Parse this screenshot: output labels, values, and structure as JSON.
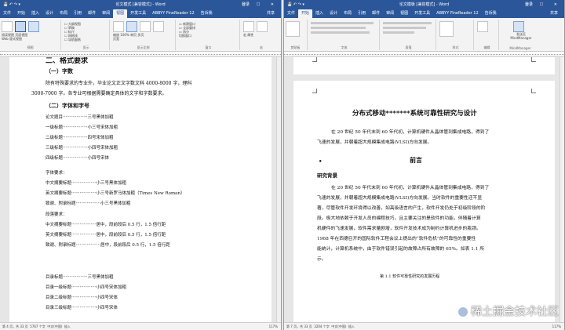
{
  "left": {
    "title": "论文模式 [兼容模式] - Word",
    "login": "登录",
    "window_controls": "— ☐ ✕",
    "share": "共享",
    "tabs": [
      "文件",
      "开始",
      "插入",
      "设计",
      "布局",
      "引用",
      "邮件",
      "审阅",
      "视图",
      "开发工具",
      "ABBYY FineReader 12",
      "告诉我"
    ],
    "active_tab_index": 8,
    "ribbon": {
      "views": [
        "阅读视图",
        "页面视图",
        "Web 版式视图"
      ],
      "show": [
        "大纲视图",
        "草稿"
      ],
      "checks": [
        "标尺",
        "网格线",
        "导航窗格"
      ],
      "zoom": [
        "缩放",
        "100%",
        "单页",
        "多页",
        "页宽"
      ],
      "window": [
        "新建窗口",
        "全部重排",
        "拆分"
      ],
      "others": [
        "切换窗口",
        "宏",
        "属性"
      ],
      "groups": [
        "视图",
        "显示",
        "显示比例",
        "窗口",
        "宏"
      ]
    },
    "status": {
      "page": "第 4 页，共 33 页",
      "words": "5767 个字",
      "lang": "中文(中国)",
      "mode": "插入",
      "zoom": "117%"
    },
    "content": {
      "h2": "二、格式要求",
      "h3a": "（一）字数",
      "p1a": "除有特殊要求的专业外，毕业论文正文字数文科 4000-8000 字，理科",
      "p1b": "3000-7000 字。各专业可根据需要确定具体的文字和字数要求。",
      "h3b": "（二）字体和字号",
      "fonts": [
        {
          "label": "论文题目",
          "val": "三号黑体加粗"
        },
        {
          "label": "一级标题",
          "val": "小三号宋体加粗"
        },
        {
          "label": "二级标题",
          "val": "四号宋体加粗"
        },
        {
          "label": "三级标题",
          "val": "小四号宋体加粗"
        },
        {
          "label": "四级标题",
          "val": "小四号宋体"
        }
      ],
      "subhead1": "字体要求：",
      "req": [
        {
          "label": "中文摘要标题",
          "val": "小三号黑体加粗"
        },
        {
          "label": "英文摘要标题",
          "val": "小三号新罗马体加粗（Times New Roman）"
        },
        {
          "label": "致谢、附录标题",
          "val": "小三号黑体加粗"
        }
      ],
      "subhead2": "段落要求：",
      "para": [
        {
          "label": "中文摘要标题",
          "val": "居中，段前段后 0.5 行，1.5 倍行距"
        },
        {
          "label": "英文摘要标题",
          "val": "居中，段前段后 0.5 行，1.5 倍行距"
        },
        {
          "label": "致谢、附录标题",
          "val": "居中，段前段后 0.5 行，1.5 倍行距"
        }
      ],
      "toc": [
        {
          "label": "目录标题",
          "val": "三号黑体加粗"
        },
        {
          "label": "目录一级标题",
          "val": "小四号宋体加粗"
        },
        {
          "label": "目录二级标题",
          "val": "小四号宋体"
        },
        {
          "label": "目录三级标题",
          "val": "小四号宋体"
        }
      ],
      "dots": "··················"
    }
  },
  "right": {
    "title": "论文模板 [兼容模式] - Word",
    "login": "登录",
    "window_controls": "— ☐ ✕",
    "share": "共享",
    "tabs": [
      "文件",
      "开始",
      "插入",
      "设计",
      "布局",
      "引用",
      "邮件",
      "审阅",
      "视图",
      "开发工具",
      "ABBYY FineReader 12",
      "告诉我"
    ],
    "active_tab_index": 1,
    "ribbon": {
      "groups": [
        "剪贴板",
        "字体",
        "段落",
        "样式",
        "编辑",
        "MindManager"
      ],
      "extras": [
        "发送至",
        "MindManager"
      ]
    },
    "status": {
      "page": "第 7 页，共 33 页",
      "words": "3204 个字",
      "lang": "中文(中国)",
      "mode": "插入",
      "zoom": "117%"
    },
    "content": {
      "title": "分布式移动*******系统可靠性研究与设计",
      "p1a": "在 20 世纪 50 年代末到 60 年代初，计算机硬件从晶体管到集成电路，得到了",
      "p1b": "飞速的发展，并朝着超大规模集成电路(VLSI)方向发展。",
      "h2": "前言",
      "h3": "研究背景",
      "body": [
        "在 20 世纪 50 年代末到 60 年代初，计算机硬件从晶体管到集成电路，得到了",
        "飞速的发展，并朝着超大规模集成电路(VLSI)方向发展。当时软件的重要性还不显",
        "著，尽管软件开发环境得以改善，如高级语言的产生，软件开发仍处于初级阶段的阶",
        "段。极大地依赖于开发人员的编程技巧，且主要关注的是软件的功能，伴随着计算",
        "机硬件的飞速发展，软件需求量剧增，软件开发技术成为制约计算机进步的瓶颈。",
        "1968 年在西德召开的国际软件工程会议上提出的“软件危机”的可靠性的重要性",
        "能统计，计算机系统中，由于软件错误引起的故障占所有故障的 65%。如表 1.1 所",
        "示。"
      ],
      "caption": "第 1.1  软件可靠性研究的发展历程"
    }
  },
  "watermark": "稀土掘金技术社区"
}
